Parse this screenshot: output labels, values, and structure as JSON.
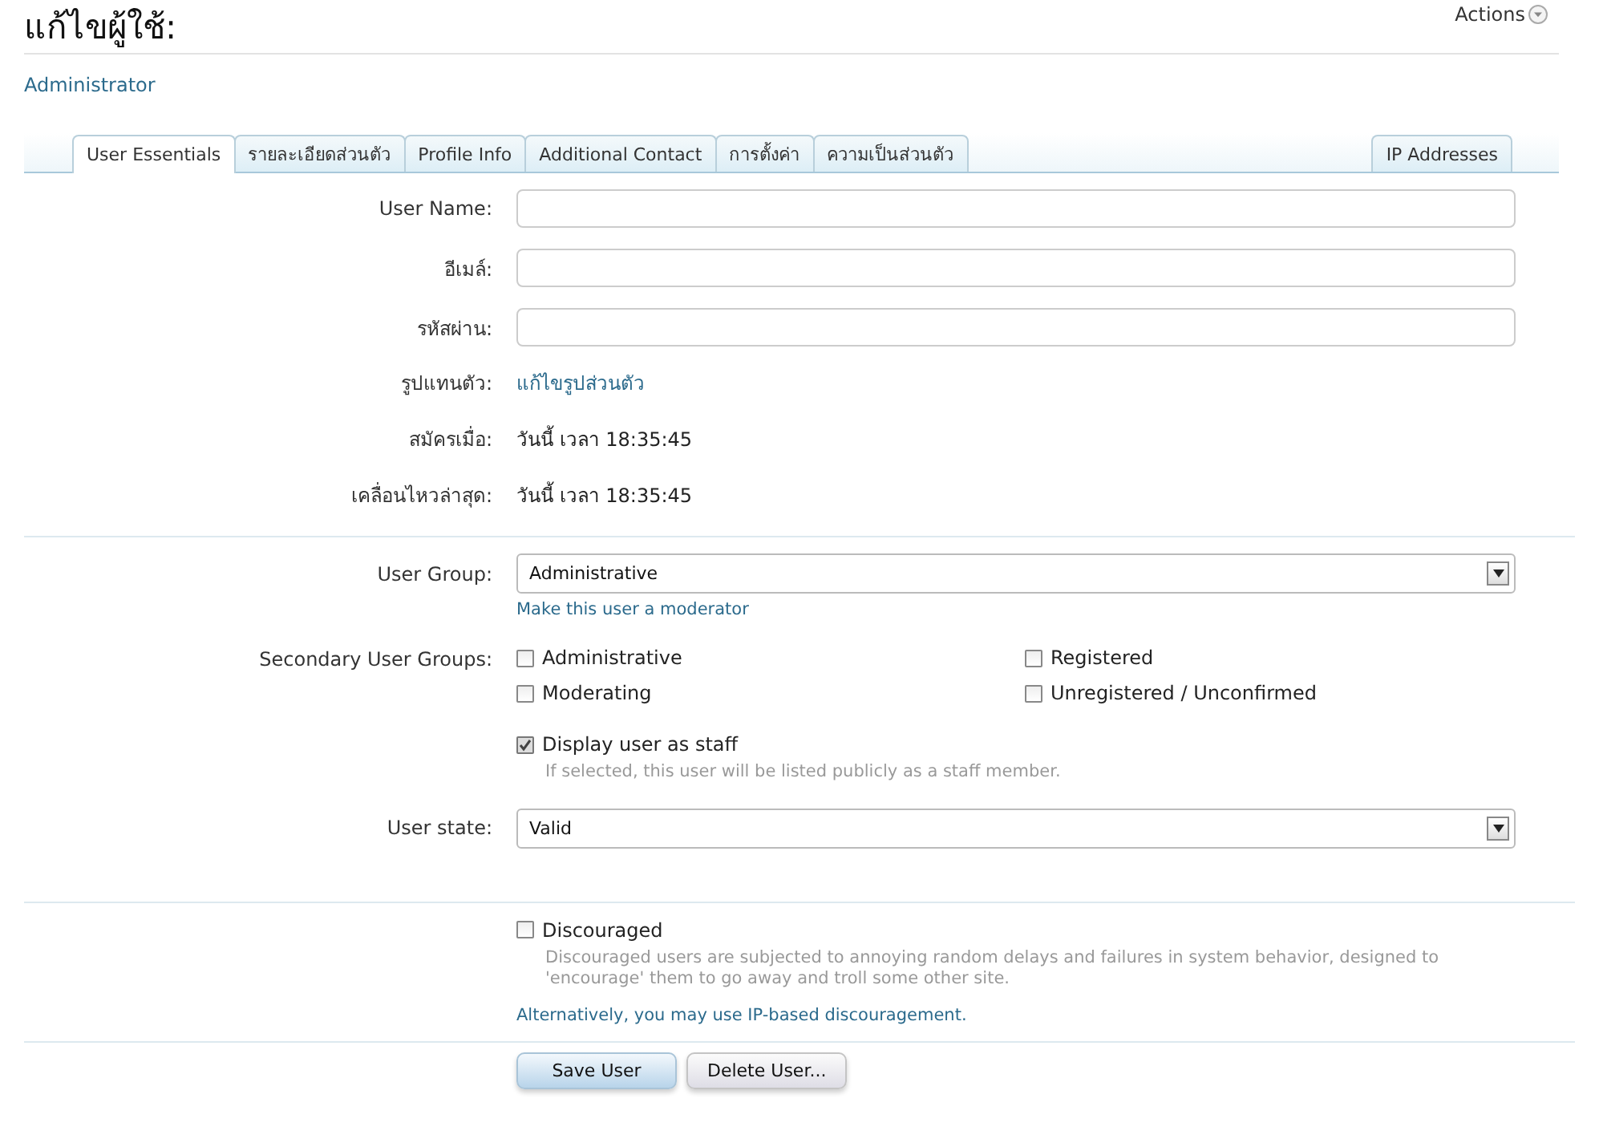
{
  "page": {
    "title": "แก้ไขผู้ใช้:",
    "actions": "Actions",
    "subtitle": "Administrator"
  },
  "tabs": [
    {
      "label": "User Essentials",
      "selected": true
    },
    {
      "label": "รายละเอียดส่วนตัว",
      "selected": false
    },
    {
      "label": "Profile Info",
      "selected": false
    },
    {
      "label": "Additional Contact",
      "selected": false
    },
    {
      "label": "การตั้งค่า",
      "selected": false
    },
    {
      "label": "ความเป็นส่วนตัว",
      "selected": false
    },
    {
      "label": "IP Addresses",
      "selected": false,
      "kind": "right"
    }
  ],
  "fields": [
    {
      "kind": "text",
      "label": "User Name:"
    },
    {
      "kind": "text",
      "label": "อีเมล์:"
    },
    {
      "kind": "password",
      "label": "รหัสผ่าน:"
    },
    {
      "kind": "link",
      "label": "รูปแทนตัว:",
      "value": "แก้ไขรูปส่วนตัว"
    },
    {
      "kind": "info",
      "label": "สมัครเมื่อ:",
      "value": "วันนี้ เวลา 18:35:45"
    },
    {
      "kind": "info",
      "label": "เคลื่อนไหวล่าสุด:",
      "value": "วันนี้ เวลา 18:35:45"
    }
  ],
  "user_group": {
    "label": "User Group:",
    "value": "Administrative",
    "link": "Make this user a moderator"
  },
  "secondary_groups": {
    "label": "Secondary User Groups:",
    "options": [
      {
        "label": "Administrative",
        "checked": false
      },
      {
        "label": "Registered",
        "checked": false
      },
      {
        "label": "Moderating",
        "checked": false
      },
      {
        "label": "Unregistered / Unconfirmed",
        "checked": false
      }
    ]
  },
  "staff": {
    "label": "Display user as staff",
    "checked": true,
    "hint": "If selected, this user will be listed publicly as a staff member."
  },
  "user_state": {
    "label": "User state:",
    "value": "Valid"
  },
  "discouraged": {
    "label": "Discouraged",
    "checked": false,
    "hint": "Discouraged users are subjected to annoying random delays and failures in system behavior, designed to 'encourage' them to go away and troll some other site.",
    "link": "Alternatively, you may use IP-based discouragement."
  },
  "buttons": [
    {
      "label": "Save User",
      "kind": "primary"
    },
    {
      "label": "Delete User...",
      "kind": "secondary"
    }
  ]
}
